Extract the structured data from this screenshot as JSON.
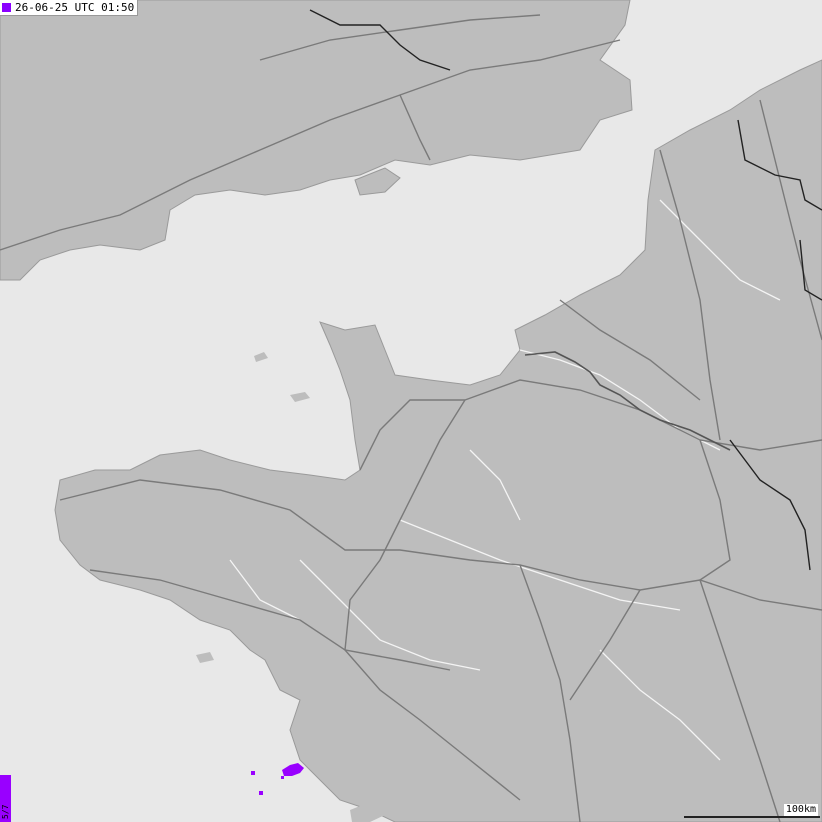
{
  "timestamp": "26-06-25 UTC 01:50",
  "legend": {
    "label": "5/7",
    "color": "#9900ff"
  },
  "scalebar": {
    "label": "100km"
  },
  "colors": {
    "sea": "#e8e8e8",
    "land": "#bdbdbd",
    "roads": "#7a7a7a",
    "borders": "#222222",
    "strike": "#9900ff"
  }
}
